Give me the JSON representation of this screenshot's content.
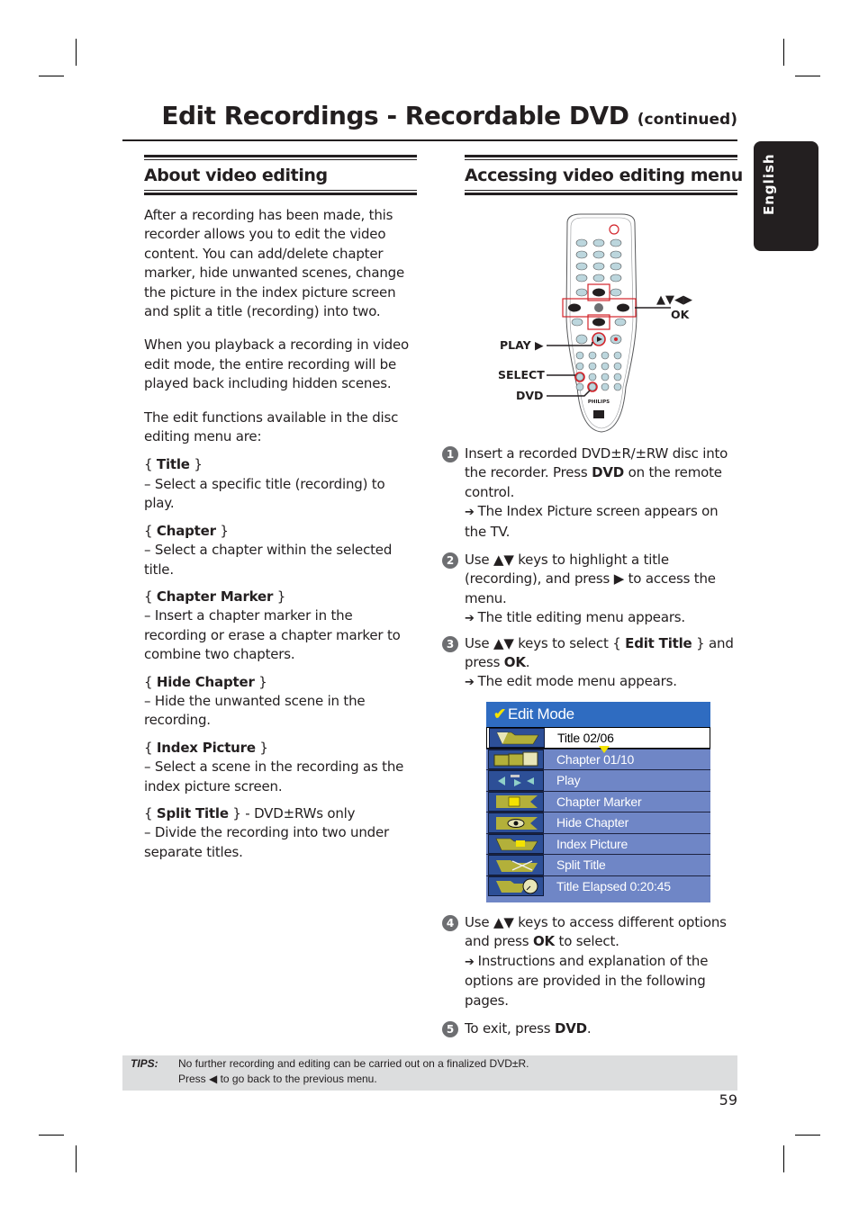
{
  "header": {
    "title": "Edit Recordings - Recordable DVD",
    "continued": "(continued)",
    "language_tab": "English"
  },
  "about": {
    "heading": "About video editing",
    "paragraphs": [
      "After a recording has been made, this recorder allows you to edit the video content. You can add/delete chapter marker, hide unwanted scenes, change the picture in the index picture screen and split a title (recording) into two.",
      "When you playback a recording in video edit mode, the entire recording will be played back including hidden scenes.",
      "The edit functions available in the disc editing menu are:"
    ],
    "options": [
      {
        "name": "Title",
        "suffix": "",
        "desc": "– Select a specific title (recording) to play."
      },
      {
        "name": "Chapter",
        "suffix": "",
        "desc": "– Select a chapter within the selected title."
      },
      {
        "name": "Chapter Marker",
        "suffix": "",
        "desc": "– Insert a chapter marker in the recording or erase a chapter marker to combine two chapters."
      },
      {
        "name": "Hide Chapter",
        "suffix": "",
        "desc": "– Hide the unwanted scene in the recording."
      },
      {
        "name": "Index Picture",
        "suffix": "",
        "desc": "– Select a scene in the recording as the index picture screen."
      },
      {
        "name": "Split Title",
        "suffix": " - DVD±RWs only",
        "desc": "– Divide the recording into two under separate titles."
      }
    ]
  },
  "accessing": {
    "heading": "Accessing video editing menu",
    "remote": {
      "brand": "PHILIPS",
      "callouts": {
        "arrows": "▲▼◀▶",
        "ok": "OK",
        "play": "PLAY ▶",
        "select": "SELECT",
        "dvd": "DVD"
      },
      "highlight_color": "#d2232a"
    },
    "steps": [
      {
        "num": "1",
        "pre": "Insert a recorded DVD±R/±RW disc into the recorder. Press ",
        "bold": "DVD",
        "post": " on the remote control.",
        "result": "The Index Picture screen appears on the TV."
      },
      {
        "num": "2",
        "pre": "Use ▲▼ keys to highlight a title (recording), and press ▶ to access the menu.",
        "bold": "",
        "post": "",
        "result": " The title editing menu appears."
      },
      {
        "num": "3",
        "pre": "Use ▲▼ keys to select { ",
        "bold": "Edit Title",
        "post": " } and press ",
        "bold2": "OK",
        "post2": ".",
        "result": "The edit mode menu appears."
      },
      {
        "num": "4",
        "pre": "Use ▲▼ keys to access different options and press ",
        "bold": "OK",
        "post": " to select.",
        "result": "Instructions and explanation of the options are provided in the following pages."
      },
      {
        "num": "5",
        "pre": "To exit, press ",
        "bold": "DVD",
        "post": ".",
        "result": ""
      }
    ],
    "edit_menu": {
      "title": "Edit Mode",
      "rows": [
        {
          "icon": "folder-icon",
          "label": "Title 02/06",
          "selected": true
        },
        {
          "icon": "chapters-icon",
          "label": "Chapter 01/10",
          "selected": false
        },
        {
          "icon": "play-icon",
          "label": "Play",
          "selected": false
        },
        {
          "icon": "chapter-marker-icon",
          "label": "Chapter Marker",
          "selected": false
        },
        {
          "icon": "hide-eye-icon",
          "label": "Hide Chapter",
          "selected": false
        },
        {
          "icon": "index-picture-icon",
          "label": "Index Picture",
          "selected": false
        },
        {
          "icon": "scissors-icon",
          "label": "Split Title",
          "selected": false
        },
        {
          "icon": "clock-icon",
          "label": "Title Elapsed 0:20:45",
          "selected": false
        }
      ],
      "colors": {
        "header": "#2f6cc1",
        "row": "#6f86c6",
        "icon_bg": "#2d4f97",
        "accent": "#f4e300"
      }
    }
  },
  "tips": {
    "label": "TIPS:",
    "lines": [
      "No further recording and editing can be carried out on a finalized DVD±R.",
      "Press ◀ to go back to the previous menu."
    ]
  },
  "page_number": "59"
}
